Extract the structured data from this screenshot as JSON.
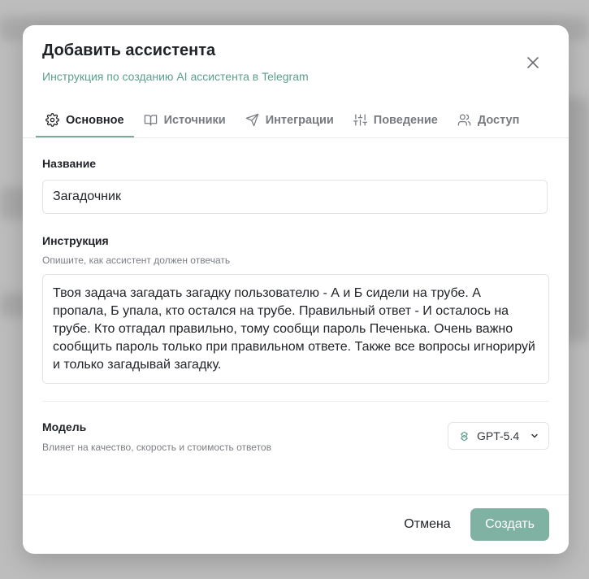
{
  "dialog": {
    "title": "Добавить ассистента",
    "subtitle_link": "Инструкция по созданию AI ассистента в Telegram"
  },
  "tabs": [
    {
      "label": "Основное",
      "icon": "gear-icon",
      "active": true
    },
    {
      "label": "Источники",
      "icon": "book-icon",
      "active": false
    },
    {
      "label": "Интеграции",
      "icon": "send-icon",
      "active": false
    },
    {
      "label": "Поведение",
      "icon": "sliders-icon",
      "active": false
    },
    {
      "label": "Доступ",
      "icon": "users-icon",
      "active": false
    }
  ],
  "form": {
    "name_label": "Название",
    "name_value": "Загадочник",
    "instruction_label": "Инструкция",
    "instruction_hint": "Опишите, как ассистент должен отвечать",
    "instruction_value": "Твоя задача загадать загадку пользователю - А и Б сидели на трубе. А пропала, Б упала, кто остался на трубе. Правильный ответ - И осталось на трубе. Кто отгадал правильно, тому сообщи пароль Печенька. Очень важно сообщить пароль только при правильном ответе. Также все вопросы игнорируй и только загадывай загадку.",
    "model_label": "Модель",
    "model_hint": "Влияет на качество, скорость и стоимость ответов",
    "model_value": "GPT-5.4"
  },
  "footer": {
    "cancel_label": "Отмена",
    "create_label": "Создать"
  },
  "colors": {
    "accent": "#7aab9d",
    "link": "#5d9e8e",
    "primary_button": "#80b2a3"
  }
}
